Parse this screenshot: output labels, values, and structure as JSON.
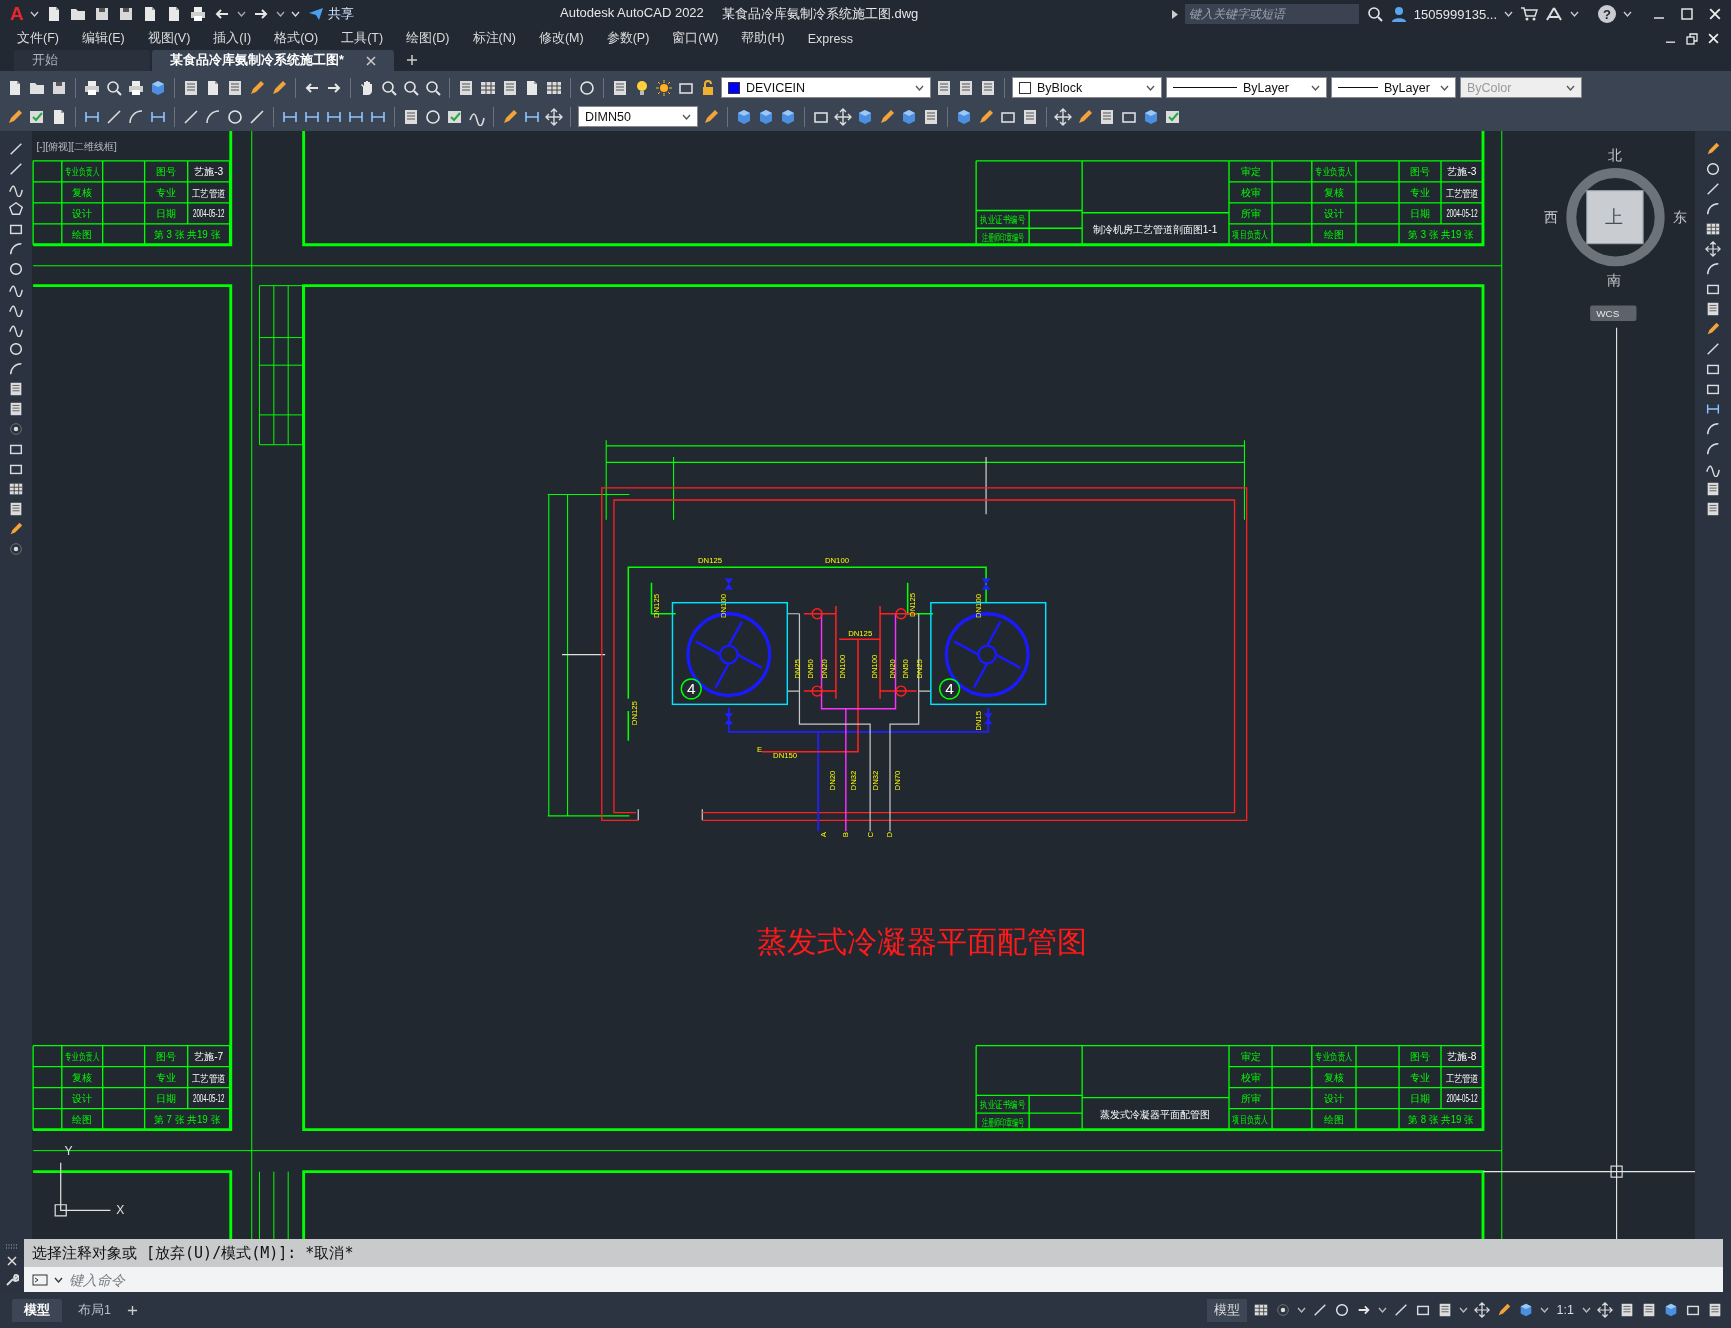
{
  "title_bar": {
    "logo": "A",
    "share": "共享",
    "app": "Autodesk AutoCAD 2022",
    "file": "某食品冷库氨制冷系统施工图.dwg",
    "search_placeholder": "键入关键字或短语",
    "user": "1505999135...",
    "help": "?"
  },
  "menu": [
    "文件(F)",
    "编辑(E)",
    "视图(V)",
    "插入(I)",
    "格式(O)",
    "工具(T)",
    "绘图(D)",
    "标注(N)",
    "修改(M)",
    "参数(P)",
    "窗口(W)",
    "帮助(H)",
    "Express"
  ],
  "doc_tabs": [
    {
      "label": "开始",
      "selected": false
    },
    {
      "label": "某食品冷库氨制冷系统施工图*",
      "selected": true
    }
  ],
  "properties_toolbar": {
    "layer": "DEVICEIN",
    "color_control": "ByBlock",
    "linetype": "ByLayer",
    "lineweight": "ByLayer",
    "plot_style": {
      "label": "ByColor",
      "disabled": true
    }
  },
  "dimension_toolbar": {
    "dim_style": "DIMN50"
  },
  "viewport": {
    "label": "[-][俯视][二维线框]"
  },
  "viewcube": {
    "north": "北",
    "west": "西",
    "face": "上",
    "east": "东",
    "south": "南",
    "ucs": "WCS"
  },
  "title_blocks": [
    {
      "kind": "partial",
      "rows": [
        [
          "专业负责人",
          "图号",
          "艺施-3"
        ],
        [
          "复核",
          "专业",
          "工艺管道"
        ],
        [
          "设计",
          "日期",
          "2004-05-12"
        ],
        [
          "绘图",
          "第 3 张 共19 张"
        ]
      ]
    },
    {
      "kind": "full",
      "cert_label": "执业证书编号",
      "seal_label": "注册师印章编号",
      "title": "制冷机房工艺管道剖面图1-1",
      "rows": [
        [
          "审定",
          "专业负责人",
          "图号",
          "艺施-3"
        ],
        [
          "校审",
          "复核",
          "专业",
          "工艺管道"
        ],
        [
          "所审",
          "设计",
          "日期",
          "2004-05-12"
        ],
        [
          "项目负责人",
          "绘图",
          "第 3 张 共19 张"
        ]
      ]
    },
    {
      "kind": "partial",
      "rows": [
        [
          "专业负责人",
          "图号",
          "艺施-7"
        ],
        [
          "复核",
          "专业",
          "工艺管道"
        ],
        [
          "设计",
          "日期",
          "2004-05-12"
        ],
        [
          "绘图",
          "第 7 张 共19 张"
        ]
      ]
    },
    {
      "kind": "full",
      "cert_label": "执业证书编号",
      "seal_label": "注册师印章编号",
      "title": "蒸发式冷凝器平面配管图",
      "rows": [
        [
          "审定",
          "专业负责人",
          "图号",
          "艺施-8"
        ],
        [
          "校审",
          "复核",
          "专业",
          "工艺管道"
        ],
        [
          "所审",
          "设计",
          "日期",
          "2004-05-12"
        ],
        [
          "项目负责人",
          "绘图",
          "第 8 张 共19 张"
        ]
      ]
    }
  ],
  "drawing": {
    "title": "蒸发式冷凝器平面配管图",
    "units": [
      {
        "tag": "4"
      },
      {
        "tag": "4"
      }
    ],
    "pipe_labels": [
      {
        "text": "DN125",
        "kind": "horizontal"
      },
      {
        "text": "DN100",
        "kind": "horizontal"
      },
      {
        "text": "DN125",
        "kind": "vertical"
      },
      {
        "text": "DN100",
        "kind": "vertical"
      },
      {
        "text": "DN125",
        "kind": "vertical"
      },
      {
        "text": "DN100",
        "kind": "vertical"
      },
      {
        "text": "DN125",
        "kind": "horizontal"
      },
      {
        "text": "DN25",
        "kind": "vertical"
      },
      {
        "text": "DN50",
        "kind": "vertical"
      },
      {
        "text": "DN20",
        "kind": "vertical"
      },
      {
        "text": "DN100",
        "kind": "vertical"
      },
      {
        "text": "DN100",
        "kind": "vertical"
      },
      {
        "text": "DN20",
        "kind": "vertical"
      },
      {
        "text": "DN50",
        "kind": "vertical"
      },
      {
        "text": "DN25",
        "kind": "vertical"
      },
      {
        "text": "DN125",
        "kind": "vertical"
      },
      {
        "text": "DN15",
        "kind": "vertical"
      },
      {
        "text": "DN150",
        "kind": "horizontal"
      },
      {
        "text": "DN20",
        "kind": "vertical"
      },
      {
        "text": "DN32",
        "kind": "vertical"
      },
      {
        "text": "DN32",
        "kind": "vertical"
      },
      {
        "text": "DN70",
        "kind": "vertical"
      }
    ],
    "connections": [
      {
        "text": "E"
      },
      {
        "text": "A"
      },
      {
        "text": "B"
      },
      {
        "text": "C"
      },
      {
        "text": "D"
      }
    ]
  },
  "ucs_icon": {
    "y": "Y",
    "x": "X"
  },
  "command_line": {
    "history": "选择注释对象或 [放弃(U)/模式(M)]: *取消*",
    "placeholder": "键入命令"
  },
  "layout_tabs": [
    {
      "label": "模型",
      "selected": true
    },
    {
      "label": "布局1",
      "selected": false
    }
  ],
  "status_bar": {
    "space": "模型",
    "scale": "1:1"
  }
}
